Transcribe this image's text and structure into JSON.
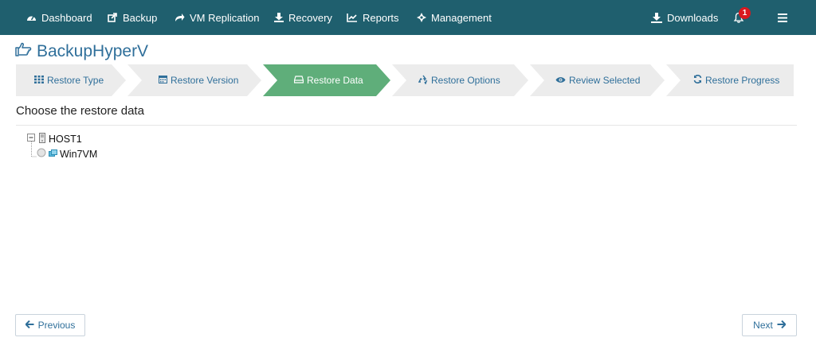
{
  "nav": {
    "items": [
      {
        "label": "Dashboard",
        "icon": "dashboard-icon"
      },
      {
        "label": "Backup",
        "icon": "share-square-icon"
      },
      {
        "label": "VM Replication",
        "icon": "share-arrow-icon"
      },
      {
        "label": "Recovery",
        "icon": "download-icon"
      },
      {
        "label": "Reports",
        "icon": "line-chart-icon"
      },
      {
        "label": "Management",
        "icon": "gear-icon"
      }
    ],
    "downloads_label": "Downloads",
    "notification_count": "1",
    "colors": {
      "bar": "#1f5f6e",
      "badge": "#d9181f"
    }
  },
  "page": {
    "title": "BackupHyperV",
    "title_icon": "hand-pointer-icon"
  },
  "wizard": {
    "steps": [
      {
        "label": "Restore Type",
        "icon": "grid-icon",
        "active": false
      },
      {
        "label": "Restore Version",
        "icon": "calendar-icon",
        "active": false
      },
      {
        "label": "Restore Data",
        "icon": "drive-icon",
        "active": true
      },
      {
        "label": "Restore Options",
        "icon": "recycle-icon",
        "active": false
      },
      {
        "label": "Review Selected",
        "icon": "eye-icon",
        "active": false
      },
      {
        "label": "Restore Progress",
        "icon": "refresh-icon",
        "active": false
      }
    ],
    "colors": {
      "active": "#5fae7a",
      "inactive": "#ececec",
      "text": "#2f6f9a"
    }
  },
  "section": {
    "title": "Choose the restore data"
  },
  "tree": {
    "host": {
      "label": "HOST1",
      "icon": "server-icon",
      "expander": "minus"
    },
    "vm": {
      "label": "Win7VM",
      "icon": "vm-icon",
      "selected": false
    }
  },
  "footer": {
    "previous_label": "Previous",
    "next_label": "Next"
  }
}
